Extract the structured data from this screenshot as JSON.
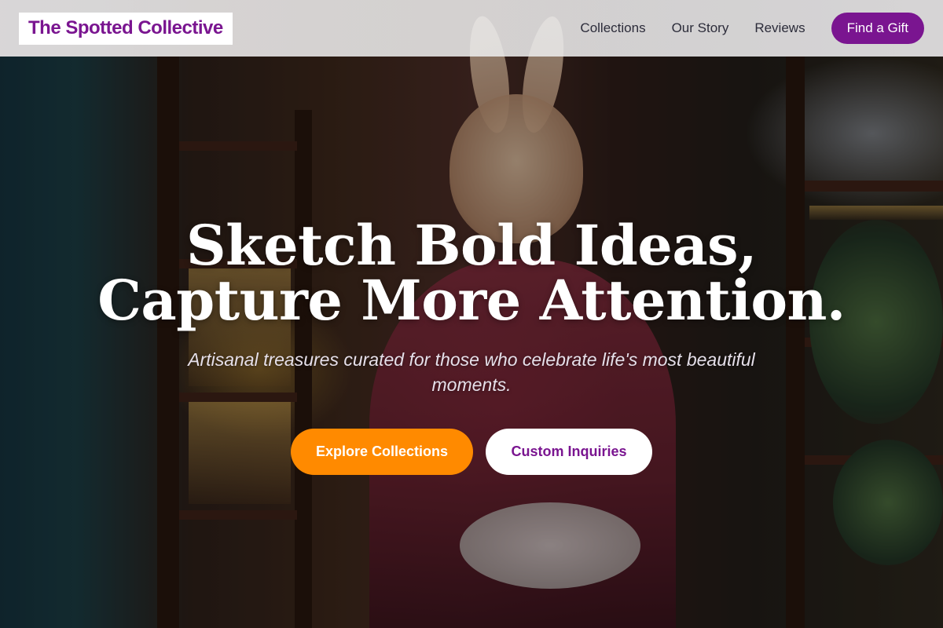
{
  "brand": {
    "name": "The Spotted Collective",
    "accent": "#7a1590"
  },
  "nav": {
    "links": [
      "Collections",
      "Our Story",
      "Reviews"
    ],
    "cta_label": "Find a Gift"
  },
  "hero": {
    "headline_line1": "Sketch Bold Ideas,",
    "headline_line2": "Capture More Attention.",
    "subheadline": "Artisanal treasures curated for those who celebrate life's most beautiful moments.",
    "primary_cta": "Explore Collections",
    "secondary_cta": "Custom Inquiries",
    "primary_color": "#ff8a00"
  }
}
